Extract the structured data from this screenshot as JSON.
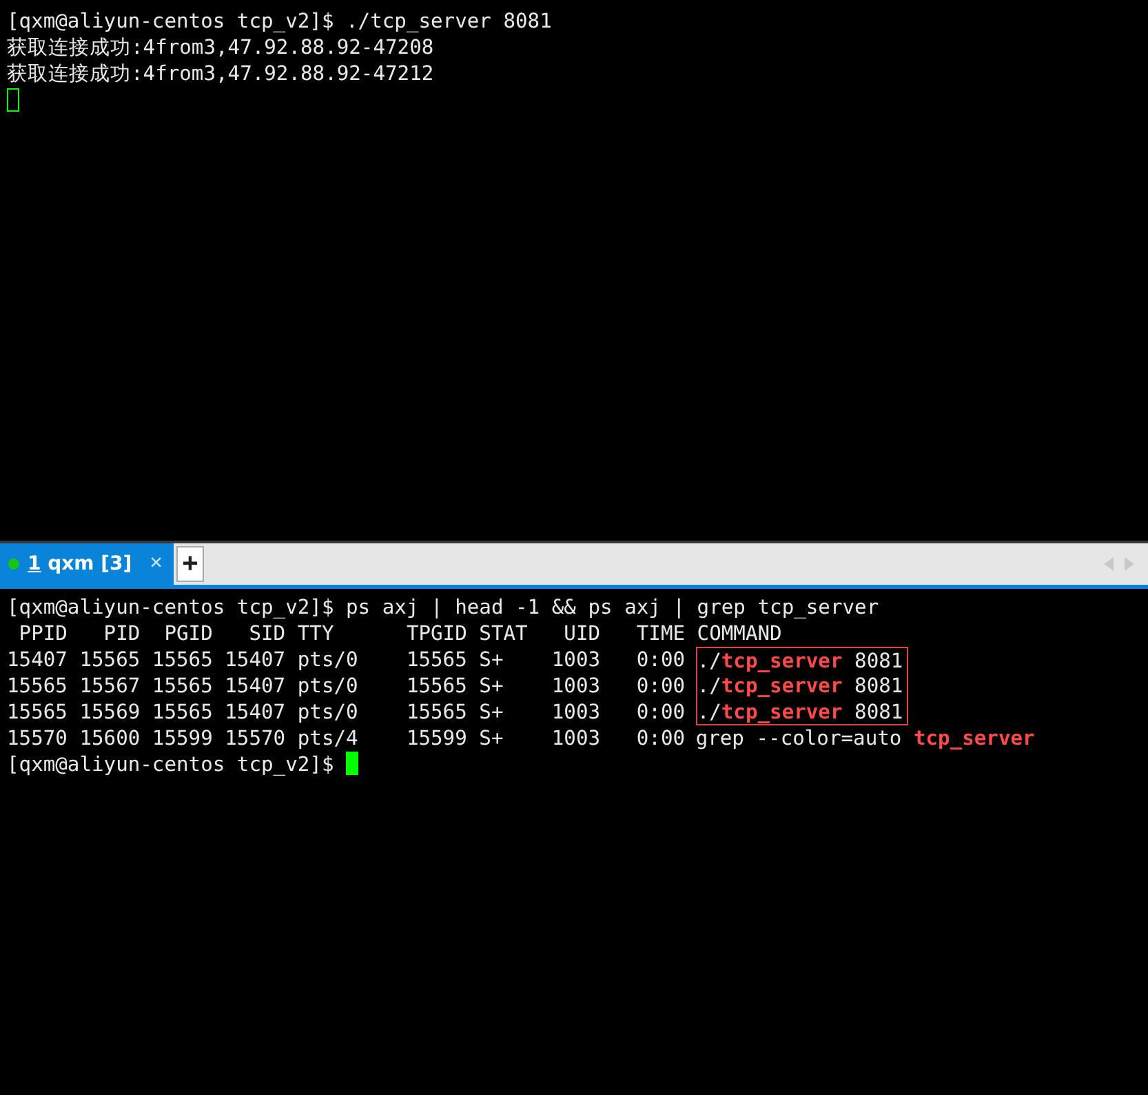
{
  "top_pane": {
    "lines": [
      "[qxm@aliyun-centos tcp_v2]$ ./tcp_server 8081",
      "获取连接成功:4from3,47.92.88.92-47208",
      "获取连接成功:4from3,47.92.88.92-47212"
    ],
    "cursor": {
      "focused": false
    }
  },
  "tab_bar": {
    "tabs": [
      {
        "index": "1",
        "title": "qxm [3]",
        "selected": true,
        "close": "×"
      }
    ],
    "new_tab": "+"
  },
  "bottom_pane": {
    "command_line": "[qxm@aliyun-centos tcp_v2]$ ps axj | head -1 && ps axj | grep tcp_server",
    "header": " PPID   PID  PGID   SID TTY      TPGID STAT   UID   TIME COMMAND",
    "rows": [
      {
        "fields": "15407 15565 15565 15407 pts/0    15565 S+    1003   0:00 ",
        "command": "./**tcp_server** 8081",
        "boxed": true
      },
      {
        "fields": "15565 15567 15565 15407 pts/0    15565 S+    1003   0:00 ",
        "command": "./**tcp_server** 8081",
        "boxed": true
      },
      {
        "fields": "15565 15569 15565 15407 pts/0    15565 S+    1003   0:00 ",
        "command": "./**tcp_server** 8081",
        "boxed": true
      },
      {
        "fields": "15570 15600 15599 15570 pts/4    15599 S+    1003   0:00 ",
        "command": "grep --color=auto **tcp_server**",
        "boxed": false
      }
    ],
    "prompt": "[qxm@aliyun-centos tcp_v2]$ ",
    "cursor": {
      "focused": true
    }
  }
}
